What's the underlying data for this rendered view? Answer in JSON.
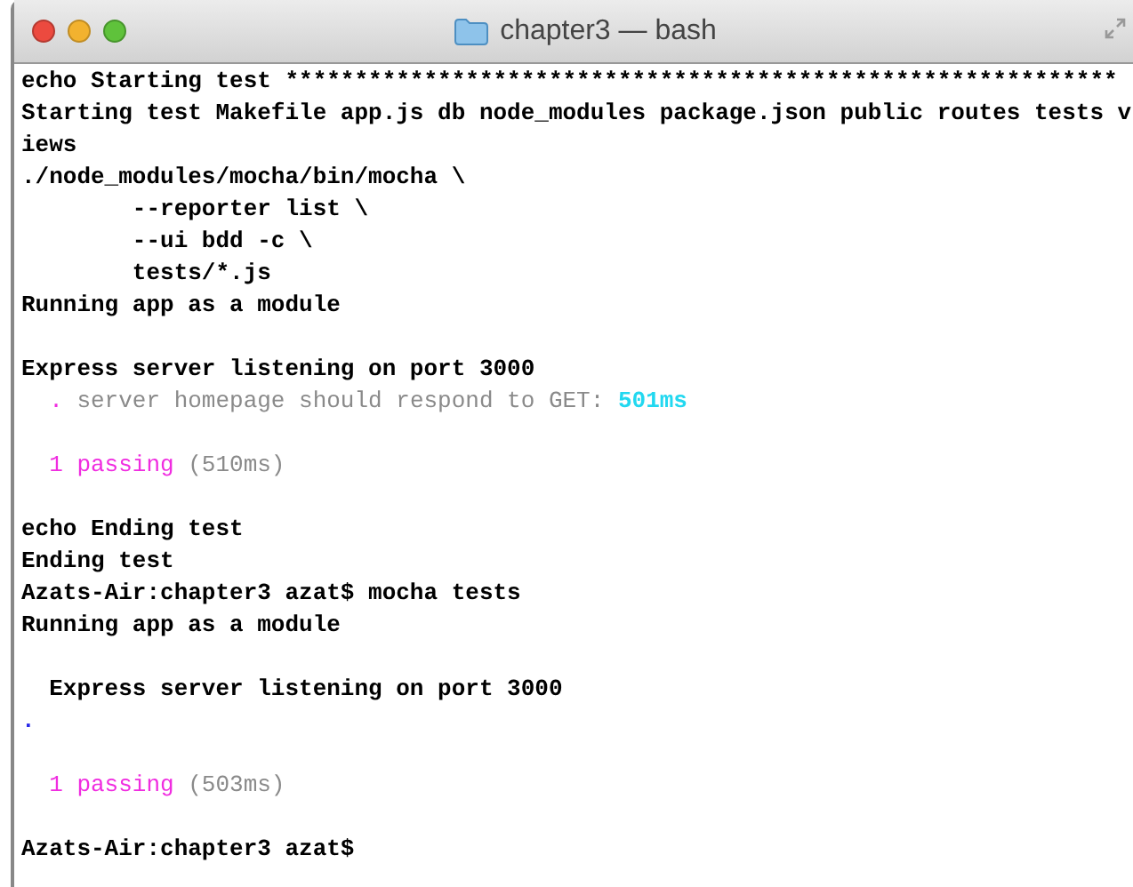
{
  "window": {
    "title": "chapter3 — bash"
  },
  "lines": [
    {
      "kind": "text",
      "segments": [
        {
          "kind": "plain",
          "text": "echo Starting test ************************************************************"
        }
      ]
    },
    {
      "kind": "text",
      "segments": [
        {
          "kind": "plain",
          "text": "Starting test Makefile app.js db node_modules package.json public routes tests v"
        }
      ]
    },
    {
      "kind": "text",
      "segments": [
        {
          "kind": "plain",
          "text": "iews"
        }
      ]
    },
    {
      "kind": "text",
      "segments": [
        {
          "kind": "plain",
          "text": "./node_modules/mocha/bin/mocha \\"
        }
      ]
    },
    {
      "kind": "text",
      "segments": [
        {
          "kind": "plain",
          "text": "        --reporter list \\"
        }
      ]
    },
    {
      "kind": "text",
      "segments": [
        {
          "kind": "plain",
          "text": "        --ui bdd -c \\"
        }
      ]
    },
    {
      "kind": "text",
      "segments": [
        {
          "kind": "plain",
          "text": "        tests/*.js"
        }
      ]
    },
    {
      "kind": "text",
      "segments": [
        {
          "kind": "plain",
          "text": "Running app as a module"
        }
      ]
    },
    {
      "kind": "blank"
    },
    {
      "kind": "text",
      "segments": [
        {
          "kind": "plain",
          "text": "Express server listening on port 3000"
        }
      ]
    },
    {
      "kind": "text",
      "segments": [
        {
          "kind": "pink",
          "text": "  ."
        },
        {
          "kind": "dim",
          "text": " server homepage should respond to GET: "
        },
        {
          "kind": "cyan",
          "text": "501ms"
        }
      ]
    },
    {
      "kind": "blank"
    },
    {
      "kind": "text",
      "segments": [
        {
          "kind": "pink",
          "text": "  1 passing"
        },
        {
          "kind": "dim",
          "text": " (510ms)"
        }
      ]
    },
    {
      "kind": "blank"
    },
    {
      "kind": "text",
      "segments": [
        {
          "kind": "plain",
          "text": "echo Ending test"
        }
      ]
    },
    {
      "kind": "text",
      "segments": [
        {
          "kind": "plain",
          "text": "Ending test"
        }
      ]
    },
    {
      "kind": "text",
      "segments": [
        {
          "kind": "plain",
          "text": "Azats-Air:chapter3 azat$ mocha tests"
        }
      ]
    },
    {
      "kind": "text",
      "segments": [
        {
          "kind": "plain",
          "text": "Running app as a module"
        }
      ]
    },
    {
      "kind": "blank"
    },
    {
      "kind": "text",
      "segments": [
        {
          "kind": "plain",
          "text": "  Express server listening on port 3000"
        }
      ]
    },
    {
      "kind": "text",
      "segments": [
        {
          "kind": "blue",
          "text": "."
        }
      ]
    },
    {
      "kind": "blank"
    },
    {
      "kind": "text",
      "segments": [
        {
          "kind": "pink",
          "text": "  1 passing"
        },
        {
          "kind": "dim",
          "text": " (503ms)"
        }
      ]
    },
    {
      "kind": "blank"
    },
    {
      "kind": "text",
      "segments": [
        {
          "kind": "plain",
          "text": "Azats-Air:chapter3 azat$"
        }
      ]
    }
  ]
}
